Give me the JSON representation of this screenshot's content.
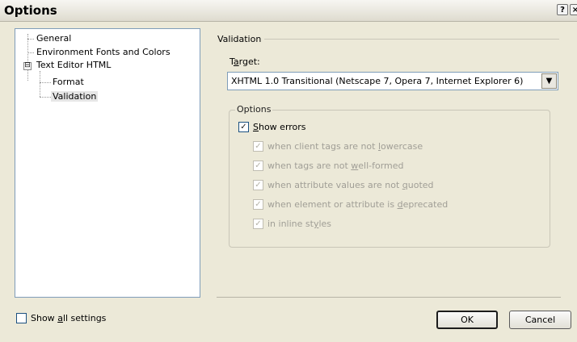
{
  "window": {
    "title": "Options",
    "help_glyph": "?",
    "close_glyph": "×"
  },
  "tree": {
    "items": [
      {
        "label": "General"
      },
      {
        "label": "Environment Fonts and Colors"
      },
      {
        "label": "Text Editor HTML",
        "expander": "⊟"
      },
      {
        "label": "Format"
      },
      {
        "label": "Validation",
        "selected": true
      }
    ]
  },
  "validation": {
    "section_label": "Validation",
    "target": {
      "label_pre": "T",
      "label_u": "a",
      "label_post": "rget:",
      "value": "XHTML 1.0 Transitional (Netscape 7, Opera 7, Internet Explorer 6)"
    },
    "options": {
      "group_label": "Options",
      "show_errors": {
        "u": "S",
        "rest": "how errors",
        "checked": true
      },
      "items": [
        {
          "pre": "when client tags are not ",
          "u": "l",
          "post": "owercase",
          "checked": true
        },
        {
          "pre": "when tags are not ",
          "u": "w",
          "post": "ell-formed",
          "checked": true
        },
        {
          "pre": "when attribute values are not ",
          "u": "q",
          "post": "uoted",
          "checked": true
        },
        {
          "pre": "when element or attribute is ",
          "u": "d",
          "post": "eprecated",
          "checked": true
        },
        {
          "pre": "in inline st",
          "u": "y",
          "post": "les",
          "checked": true
        }
      ]
    }
  },
  "footer": {
    "show_all": {
      "pre": "Show ",
      "u": "a",
      "post": "ll settings",
      "checked": false
    },
    "ok_label": "OK",
    "cancel_label": "Cancel"
  },
  "check_glyph": "✓"
}
